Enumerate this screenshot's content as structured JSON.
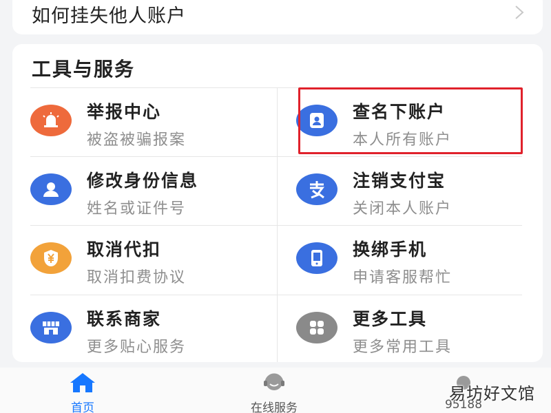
{
  "top_card": {
    "title": "如何挂失他人账户"
  },
  "tools": {
    "section_title": "工具与服务",
    "items": [
      {
        "name": "举报中心",
        "desc": "被盗被骗报案",
        "icon": "alarm-light-icon",
        "color": "#ee6a3c"
      },
      {
        "name": "查名下账户",
        "desc": "本人所有账户",
        "icon": "contact-card-icon",
        "color": "#3a6fe0"
      },
      {
        "name": "修改身份信息",
        "desc": "姓名或证件号",
        "icon": "user-icon",
        "color": "#3a6fe0"
      },
      {
        "name": "注销支付宝",
        "desc": "关闭本人账户",
        "icon": "alipay-icon",
        "color": "#3a6fe0"
      },
      {
        "name": "取消代扣",
        "desc": "取消扣费协议",
        "icon": "yuan-shield-icon",
        "color": "#f2a23a"
      },
      {
        "name": "换绑手机",
        "desc": "申请客服帮忙",
        "icon": "phone-icon",
        "color": "#3a6fe0"
      },
      {
        "name": "联系商家",
        "desc": "更多贴心服务",
        "icon": "store-icon",
        "color": "#3a6fe0"
      },
      {
        "name": "更多工具",
        "desc": "更多常用工具",
        "icon": "grid-icon",
        "color": "#8a8a8a"
      }
    ],
    "highlight_color": "#e0212b"
  },
  "bottom_nav": {
    "home_label": "首页",
    "service_label": "在线服务",
    "phone_label": "95188",
    "active_color": "#1677ff"
  },
  "watermark": "易坊好文馆"
}
